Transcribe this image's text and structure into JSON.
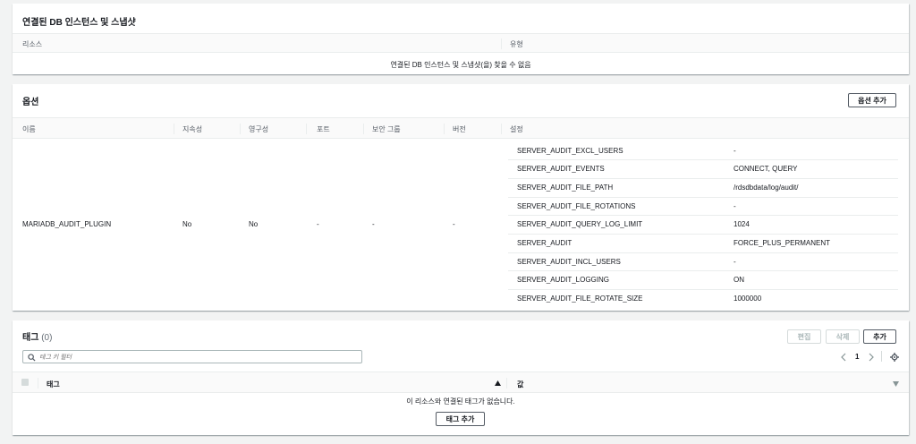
{
  "connected": {
    "title": "연결된 DB 인스턴스 및 스냅샷",
    "col_resource": "리소스",
    "col_type": "유형",
    "empty": "연결된 DB 인스턴스 및 스냅샷(을) 찾을 수 없음"
  },
  "options": {
    "title": "옵션",
    "add_button": "옵션 추가",
    "columns": [
      "이름",
      "지속성",
      "영구성",
      "포트",
      "보안 그룹",
      "버전",
      "설정"
    ],
    "row": {
      "name": "MARIADB_AUDIT_PLUGIN",
      "persistent": "No",
      "permanent": "No",
      "port": "-",
      "security_group": "-",
      "version": "-"
    },
    "settings": [
      {
        "key": "SERVER_AUDIT_EXCL_USERS",
        "value": "-"
      },
      {
        "key": "SERVER_AUDIT_EVENTS",
        "value": "CONNECT, QUERY"
      },
      {
        "key": "SERVER_AUDIT_FILE_PATH",
        "value": "/rdsdbdata/log/audit/"
      },
      {
        "key": "SERVER_AUDIT_FILE_ROTATIONS",
        "value": "-"
      },
      {
        "key": "SERVER_AUDIT_QUERY_LOG_LIMIT",
        "value": "1024"
      },
      {
        "key": "SERVER_AUDIT",
        "value": "FORCE_PLUS_PERMANENT"
      },
      {
        "key": "SERVER_AUDIT_INCL_USERS",
        "value": "-"
      },
      {
        "key": "SERVER_AUDIT_LOGGING",
        "value": "ON"
      },
      {
        "key": "SERVER_AUDIT_FILE_ROTATE_SIZE",
        "value": "1000000"
      }
    ]
  },
  "tags": {
    "title": "태그",
    "count": "(0)",
    "edit_button": "편집",
    "delete_button": "삭제",
    "add_button": "추가",
    "search_placeholder": "태그 키 필터",
    "page": "1",
    "col_tag": "태그",
    "col_value": "값",
    "empty": "이 리소스와 연결된 태그가 없습니다.",
    "add_tag_button": "태그 추가"
  }
}
